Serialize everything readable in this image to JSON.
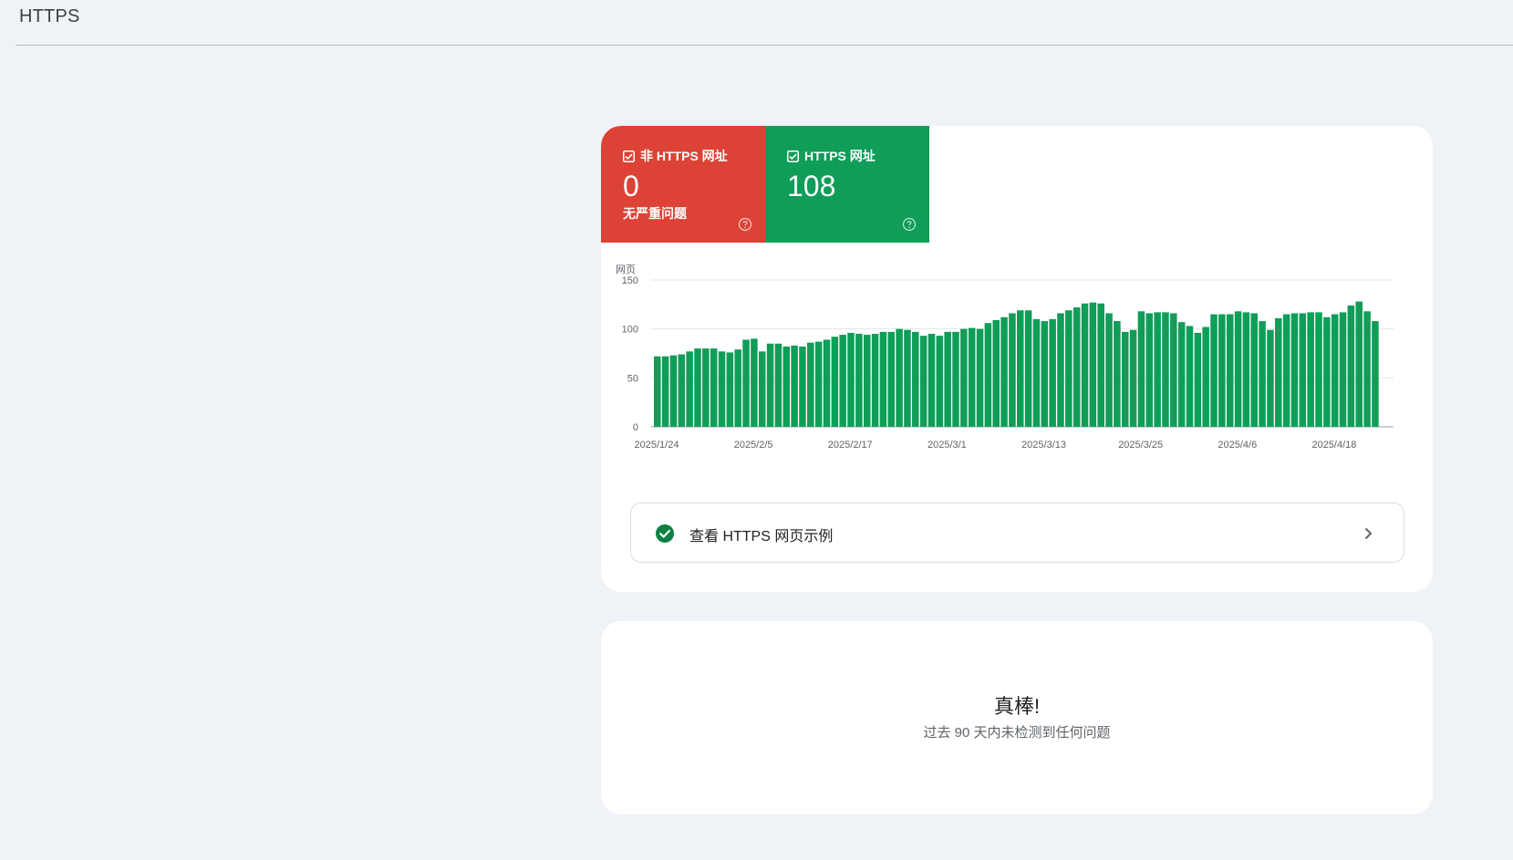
{
  "header": {
    "title": "HTTPS"
  },
  "summary": {
    "non_https": {
      "label": "非 HTTPS 网址",
      "value": "0",
      "sub": "无严重问题",
      "color": "#dc4236"
    },
    "https": {
      "label": "HTTPS 网址",
      "value": "108",
      "color": "#0f9d58"
    }
  },
  "chart_data": {
    "type": "bar",
    "ylabel": "网页",
    "ylim": [
      0,
      150
    ],
    "yticks": [
      0,
      50,
      100,
      150
    ],
    "xtick_labels": [
      "2025/1/24",
      "2025/2/5",
      "2025/2/17",
      "2025/3/1",
      "2025/3/13",
      "2025/3/25",
      "2025/4/6",
      "2025/4/18"
    ],
    "xtick_index": [
      0,
      12,
      24,
      36,
      48,
      60,
      72,
      84
    ],
    "bar_color": "#0f9d58",
    "values": [
      72,
      72,
      73,
      74,
      77,
      80,
      80,
      80,
      77,
      76,
      79,
      89,
      90,
      77,
      85,
      85,
      82,
      83,
      82,
      86,
      87,
      89,
      92,
      94,
      96,
      95,
      94,
      95,
      97,
      97,
      100,
      99,
      97,
      93,
      95,
      93,
      97,
      97,
      100,
      101,
      100,
      106,
      109,
      112,
      116,
      119,
      119,
      110,
      108,
      110,
      116,
      119,
      122,
      126,
      127,
      126,
      116,
      108,
      97,
      99,
      118,
      116,
      117,
      117,
      116,
      107,
      103,
      96,
      102,
      115,
      115,
      115,
      118,
      117,
      116,
      108,
      99,
      111,
      115,
      116,
      116,
      117,
      117,
      112,
      115,
      117,
      124,
      128,
      118,
      108
    ]
  },
  "example": {
    "label": "查看 HTTPS 网页示例"
  },
  "empty_state": {
    "title": "真棒!",
    "subtitle": "过去 90 天内未检测到任何问题"
  }
}
